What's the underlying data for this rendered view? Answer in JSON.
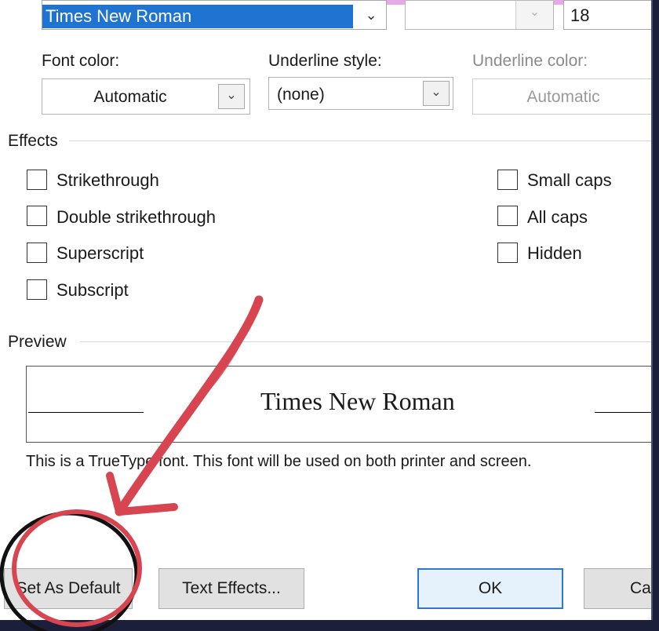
{
  "font": {
    "selected": "Times New Roman",
    "size": "18"
  },
  "font_color": {
    "label": "Font color:",
    "value": "Automatic"
  },
  "underline_style": {
    "label": "Underline style:",
    "value": "(none)"
  },
  "underline_color": {
    "label": "Underline color:",
    "value": "Automatic"
  },
  "effects": {
    "title": "Effects",
    "left": [
      {
        "label": "Strikethrough",
        "checked": false
      },
      {
        "label": "Double strikethrough",
        "checked": false
      },
      {
        "label": "Superscript",
        "checked": false
      },
      {
        "label": "Subscript",
        "checked": false
      }
    ],
    "right": [
      {
        "label": "Small caps",
        "checked": false
      },
      {
        "label": "All caps",
        "checked": false
      },
      {
        "label": "Hidden",
        "checked": false
      }
    ]
  },
  "preview": {
    "title": "Preview",
    "sample": "Times New Roman",
    "info": "This is a TrueType font. This font will be used on both printer and screen."
  },
  "buttons": {
    "set_default": "Set As Default",
    "text_effects": "Text Effects...",
    "ok": "OK",
    "cancel": "Ca"
  },
  "annotation_color": "#d64550",
  "circle_color": "#111111"
}
